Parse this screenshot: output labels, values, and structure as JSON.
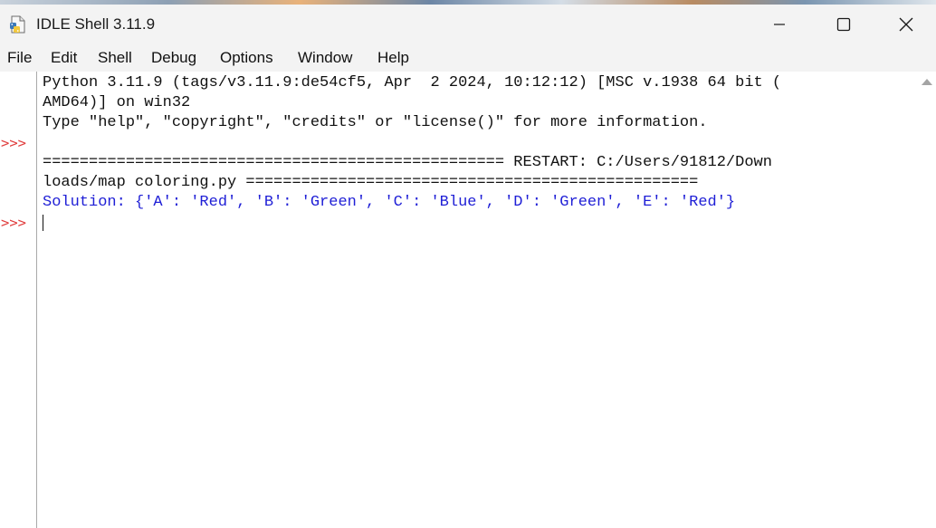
{
  "window": {
    "title": "IDLE Shell 3.11.9",
    "icons": {
      "app": "python-idle-icon",
      "minimize": "minimize-icon",
      "maximize": "maximize-icon",
      "close": "close-icon"
    }
  },
  "menu": {
    "items": [
      "File",
      "Edit",
      "Shell",
      "Debug",
      "Options",
      "Window",
      "Help"
    ]
  },
  "shell": {
    "prompt": ">>>",
    "lines": [
      "Python 3.11.9 (tags/v3.11.9:de54cf5, Apr  2 2024, 10:12:12) [MSC v.1938 64 bit (",
      "AMD64)] on win32",
      "Type \"help\", \"copyright\", \"credits\" or \"license()\" for more information.",
      "",
      "================================================== RESTART: C:/Users/91812/Down",
      "loads/map coloring.py =================================================",
      "Solution: {'A': 'Red', 'B': 'Green', 'C': 'Blue', 'D': 'Green', 'E': 'Red'}",
      ""
    ]
  },
  "colors": {
    "prompt": "#e03c3c",
    "output_blue": "#1f1fd6",
    "titlebar_bg": "#f3f3f3"
  }
}
